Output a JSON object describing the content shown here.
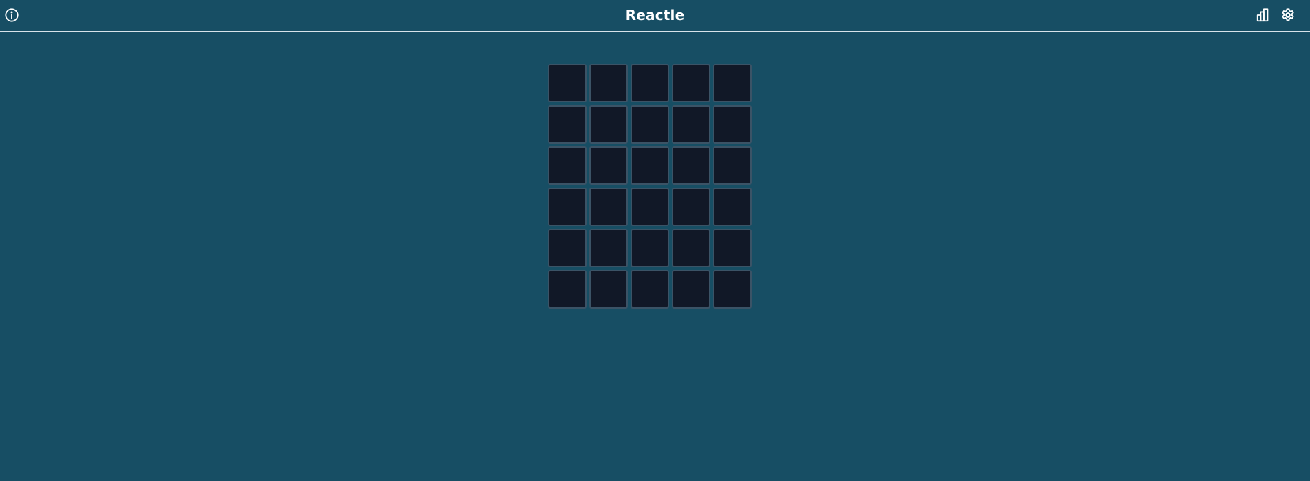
{
  "header": {
    "title": "Reactle",
    "icons": {
      "left": "info-icon",
      "right": [
        "stats-icon",
        "gear-icon"
      ]
    }
  },
  "board": {
    "rows": 6,
    "columns": 5,
    "cells": [
      [
        "",
        "",
        "",
        "",
        ""
      ],
      [
        "",
        "",
        "",
        "",
        ""
      ],
      [
        "",
        "",
        "",
        "",
        ""
      ],
      [
        "",
        "",
        "",
        "",
        ""
      ],
      [
        "",
        "",
        "",
        "",
        ""
      ],
      [
        "",
        "",
        "",
        "",
        ""
      ]
    ]
  },
  "colors": {
    "background": "#174e64",
    "tile_fill": "#111827",
    "tile_border": "#3b5366",
    "header_rule": "#d8e3ea",
    "text": "#ffffff"
  }
}
